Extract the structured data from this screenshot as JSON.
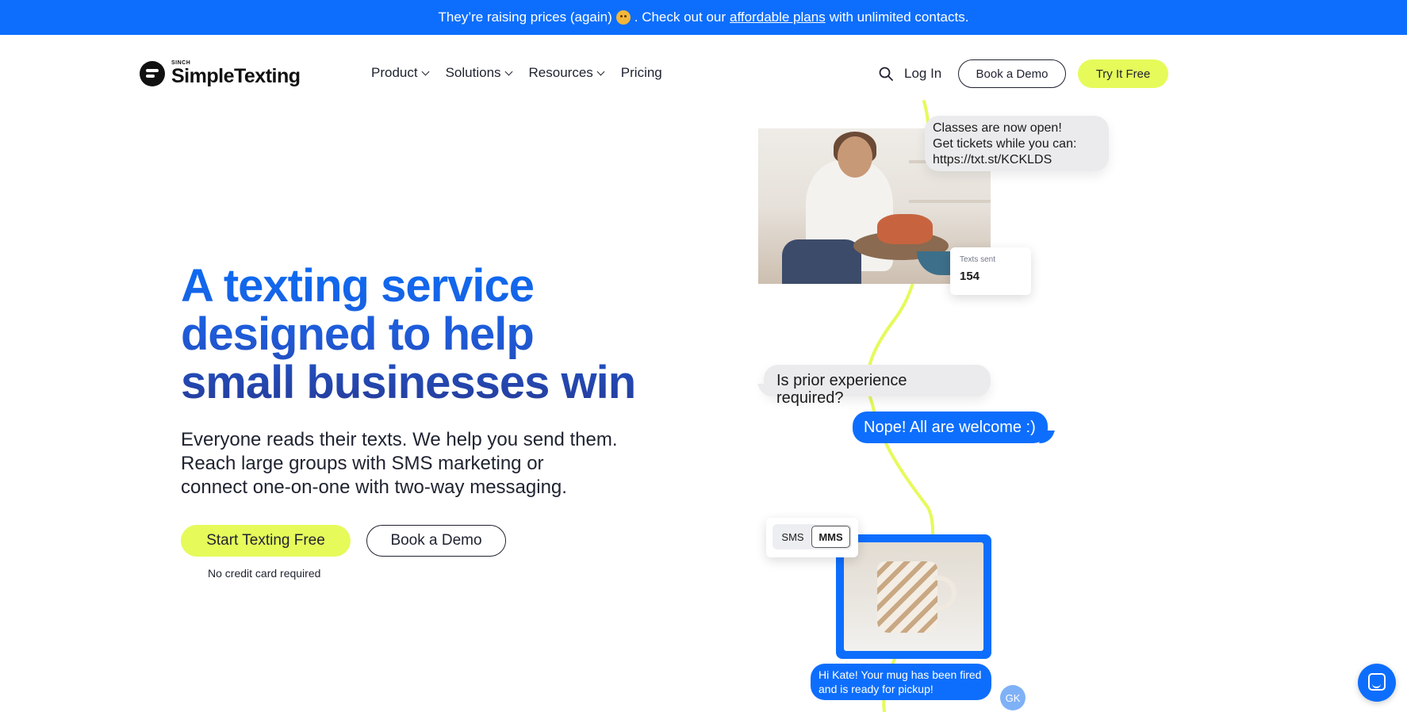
{
  "promo": {
    "text_before": "They’re raising prices (again)",
    "emoji_icon": "hugging-face-emoji-icon",
    "text_middle": ". Check out our",
    "link": "affordable plans",
    "text_after": "with unlimited contacts."
  },
  "logo": {
    "superscript": "SINCH",
    "name": "SimpleTexting"
  },
  "nav": {
    "items": [
      {
        "label": "Product",
        "dropdown": true
      },
      {
        "label": "Solutions",
        "dropdown": true
      },
      {
        "label": "Resources",
        "dropdown": true
      },
      {
        "label": "Pricing",
        "dropdown": false
      }
    ],
    "login": "Log In",
    "book_demo": "Book a Demo",
    "try_free": "Try It Free"
  },
  "hero": {
    "title_line1": "A texting service",
    "title_line2": "designed to help",
    "title_line3": "small businesses win",
    "subtitle_line1": "Everyone reads their texts. We help you send them.",
    "subtitle_line2": "Reach large groups with SMS marketing or",
    "subtitle_line3": "connect one-on-one with two-way messaging.",
    "cta_primary": "Start Texting Free",
    "cta_secondary": "Book a Demo",
    "note": "No credit card required"
  },
  "illustration": {
    "bubble1_line1": "Classes are now open!",
    "bubble1_line2": "Get tickets while you can:",
    "bubble1_line3": "https://txt.st/KCKLDS",
    "stats_label": "Texts sent",
    "stats_value": "154",
    "bubble2": "Is prior experience required?",
    "bubble3": "Nope! All are welcome :)",
    "toggle_sms": "SMS",
    "toggle_mms": "MMS",
    "toggle_selected": "MMS",
    "bubble4_line1": "Hi Kate! Your mug has been fired",
    "bubble4_line2": "and is ready for pickup!",
    "avatar_initials": "GK"
  },
  "colors": {
    "brand_blue": "#0d6efd",
    "accent_yellow": "#e6fa5a",
    "title_navy": "#263c99"
  }
}
